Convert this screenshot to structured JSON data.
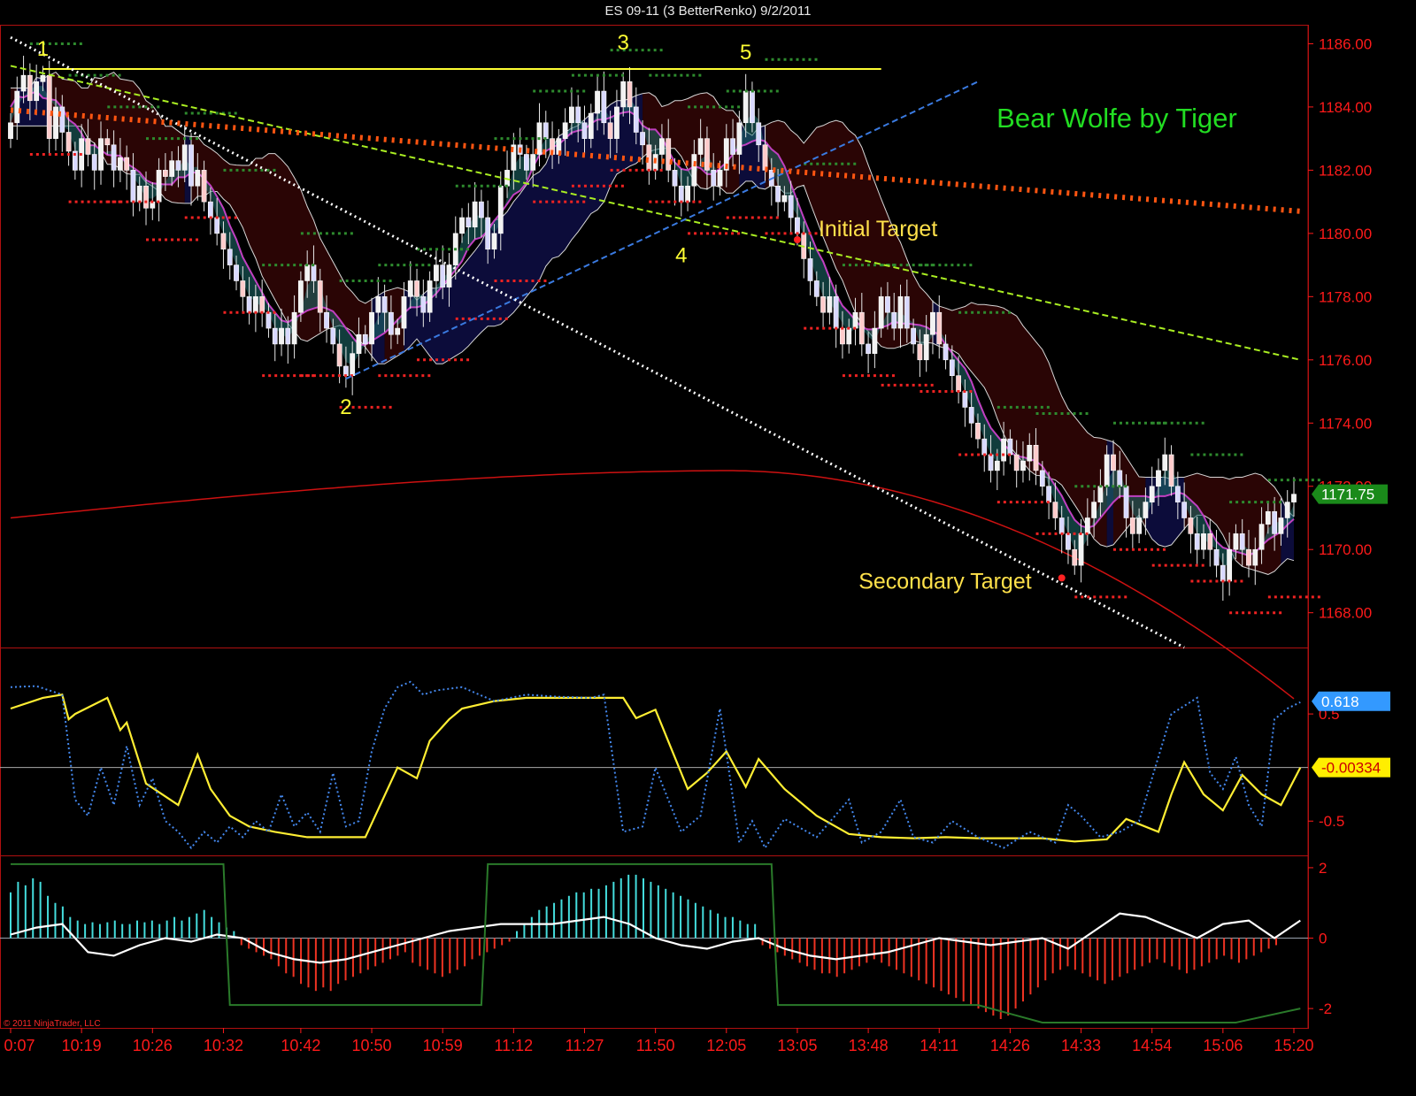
{
  "window": {
    "title": "ES 09-11 (3 BetterRenko)  9/2/2011"
  },
  "copyright": "© 2011 NinjaTrader, LLC",
  "colors": {
    "background": "#000000",
    "axis_text": "#ff1a1a",
    "panel_border": "#b01010",
    "wave_label": "#ffff33",
    "study_title": "#22dd22",
    "last_price_tag": "#1a8a1a",
    "osc_tag_blue": "#3399ff",
    "osc_tag_yellow": "#ffee00"
  },
  "chart_data": [
    {
      "type": "candlestick",
      "panel": "price",
      "title": "Bear Wolfe by Tiger",
      "ylim": [
        1166.9,
        1186.6
      ],
      "y_ticks": [
        "1186.00",
        "1184.00",
        "1182.00",
        "1180.00",
        "1178.00",
        "1176.00",
        "1174.00",
        "1172.00",
        "1170.00",
        "1168.00"
      ],
      "last_price": "1171.75",
      "wave_points": [
        {
          "label": "1",
          "bar": 5,
          "price": 1185.0
        },
        {
          "label": "2",
          "bar": 52,
          "price": 1175.3
        },
        {
          "label": "3",
          "bar": 95,
          "price": 1185.2
        },
        {
          "label": "4",
          "bar": 104,
          "price": 1180.1
        },
        {
          "label": "5",
          "bar": 114,
          "price": 1184.9
        }
      ],
      "targets": [
        {
          "label": "Initial Target",
          "bar": 122,
          "price": 1179.8
        },
        {
          "label": "Secondary Target",
          "bar": 163,
          "price": 1169.1
        }
      ],
      "annotation_lines": [
        {
          "name": "resistance-3-5",
          "price": 1185.2,
          "from_bar": 5,
          "to_bar": 135
        },
        {
          "name": "target-1-4",
          "from": [
            0,
            1185.3
          ],
          "to": [
            200,
            1176.0
          ]
        },
        {
          "name": "line-2-4",
          "from": [
            52,
            1175.4
          ],
          "to": [
            150,
            1184.8
          ]
        },
        {
          "name": "line-1-3",
          "from": [
            0,
            1186.2
          ],
          "to": [
            182,
            1166.9
          ]
        },
        {
          "name": "moving-avg-dots",
          "from": [
            0,
            1183.9
          ],
          "to": [
            200,
            1180.7
          ]
        }
      ],
      "closes": [
        1183.5,
        1184.5,
        1185.0,
        1184.2,
        1184.8,
        1185.0,
        1183.0,
        1184.0,
        1183.2,
        1182.6,
        1182.0,
        1183.0,
        1182.5,
        1182.0,
        1183.0,
        1182.8,
        1182.0,
        1182.4,
        1182.0,
        1181.0,
        1181.5,
        1180.8,
        1181.0,
        1182.0,
        1181.8,
        1182.3,
        1182.0,
        1182.8,
        1181.5,
        1182.0,
        1181.0,
        1180.5,
        1180.0,
        1179.5,
        1179.0,
        1178.5,
        1178.0,
        1177.5,
        1178.0,
        1177.5,
        1177.0,
        1176.5,
        1177.0,
        1176.5,
        1177.5,
        1178.5,
        1179.0,
        1178.5,
        1177.5,
        1177.0,
        1176.5,
        1175.8,
        1175.5,
        1176.2,
        1176.8,
        1176.5,
        1177.5,
        1178.0,
        1177.5,
        1176.8,
        1177.0,
        1178.0,
        1178.5,
        1178.0,
        1177.5,
        1178.5,
        1179.0,
        1178.3,
        1179.0,
        1180.0,
        1180.5,
        1180.2,
        1181.0,
        1180.5,
        1179.5,
        1180.0,
        1181.5,
        1182.0,
        1182.8,
        1182.5,
        1182.0,
        1182.5,
        1183.5,
        1183.0,
        1182.5,
        1183.0,
        1183.5,
        1184.0,
        1183.5,
        1183.0,
        1183.8,
        1184.5,
        1183.5,
        1183.0,
        1184.0,
        1184.8,
        1184.0,
        1183.2,
        1182.8,
        1182.0,
        1182.5,
        1183.0,
        1182.0,
        1181.5,
        1181.0,
        1181.5,
        1182.5,
        1183.0,
        1182.0,
        1181.5,
        1182.0,
        1183.0,
        1182.5,
        1183.5,
        1184.5,
        1183.5,
        1182.8,
        1182.0,
        1181.5,
        1181.0,
        1181.2,
        1180.5,
        1180.0,
        1179.2,
        1178.5,
        1178.0,
        1177.5,
        1178.0,
        1177.0,
        1176.5,
        1177.0,
        1177.5,
        1176.5,
        1176.2,
        1177.0,
        1178.0,
        1177.5,
        1177.0,
        1178.0,
        1177.0,
        1176.5,
        1176.0,
        1176.8,
        1177.5,
        1176.5,
        1176.0,
        1175.5,
        1175.0,
        1174.5,
        1174.0,
        1173.5,
        1173.0,
        1172.5,
        1172.8,
        1173.5,
        1173.0,
        1172.5,
        1172.8,
        1173.3,
        1172.5,
        1172.0,
        1171.5,
        1171.0,
        1170.5,
        1170.0,
        1169.5,
        1170.5,
        1171.0,
        1171.5,
        1172.0,
        1173.0,
        1172.5,
        1172.0,
        1171.0,
        1170.5,
        1171.0,
        1171.5,
        1172.0,
        1172.5,
        1173.0,
        1172.0,
        1171.5,
        1171.0,
        1170.5,
        1170.0,
        1170.5,
        1170.0,
        1169.5,
        1169.0,
        1170.0,
        1170.5,
        1170.0,
        1169.5,
        1170.0,
        1170.8,
        1171.2,
        1170.5,
        1171.0,
        1171.5,
        1171.75
      ]
    },
    {
      "type": "line",
      "panel": "oscillator",
      "ylim": [
        -0.82,
        1.12
      ],
      "y_ticks": [
        "0.5",
        "-0.5"
      ],
      "zero_line": 0,
      "tags": [
        {
          "text": "0.618",
          "value": 0.618,
          "color": "#3399ff"
        },
        {
          "text": "-0.00334",
          "value": 0.0,
          "color": "#ffee00"
        }
      ],
      "series": [
        {
          "style": "solid",
          "color": "#ffee33",
          "x": [
            0,
            5,
            8,
            9,
            10,
            15,
            17,
            18,
            21,
            26,
            29,
            31,
            34,
            37,
            41,
            46,
            50,
            55,
            60,
            63,
            65,
            68,
            70,
            75,
            80,
            85,
            90,
            95,
            97,
            100,
            105,
            108,
            111,
            114,
            116,
            120,
            125,
            130,
            135,
            140,
            145,
            150,
            155,
            160,
            165,
            170,
            173,
            178,
            180,
            182,
            185,
            188,
            191,
            194,
            197,
            200
          ],
          "y": [
            0.55,
            0.65,
            0.68,
            0.45,
            0.5,
            0.65,
            0.35,
            0.42,
            -0.15,
            -0.35,
            0.12,
            -0.2,
            -0.45,
            -0.55,
            -0.6,
            -0.65,
            -0.65,
            -0.65,
            0.0,
            -0.1,
            0.25,
            0.45,
            0.55,
            0.62,
            0.65,
            0.65,
            0.65,
            0.65,
            0.46,
            0.54,
            -0.2,
            -0.05,
            0.15,
            -0.18,
            0.08,
            -0.2,
            -0.45,
            -0.62,
            -0.65,
            -0.66,
            -0.65,
            -0.66,
            -0.66,
            -0.66,
            -0.69,
            -0.67,
            -0.48,
            -0.6,
            -0.25,
            0.05,
            -0.25,
            -0.4,
            -0.07,
            -0.25,
            -0.35,
            0.0
          ]
        },
        {
          "style": "dotted",
          "color": "#4488ee",
          "x": [
            0,
            4,
            8,
            10,
            12,
            14,
            16,
            18,
            20,
            22,
            24,
            26,
            28,
            30,
            32,
            34,
            36,
            38,
            40,
            42,
            44,
            46,
            48,
            50,
            52,
            54,
            56,
            58,
            60,
            62,
            64,
            66,
            70,
            75,
            80,
            85,
            90,
            92,
            95,
            98,
            100,
            104,
            107,
            110,
            113,
            115,
            117,
            120,
            125,
            130,
            132,
            135,
            138,
            140,
            143,
            146,
            150,
            154,
            158,
            162,
            164,
            166,
            169,
            172,
            175,
            180,
            184,
            186,
            188,
            190,
            192,
            194,
            196,
            198,
            200
          ],
          "y": [
            0.75,
            0.76,
            0.68,
            -0.3,
            -0.45,
            0.0,
            -0.35,
            0.2,
            -0.35,
            -0.1,
            -0.5,
            -0.6,
            -0.75,
            -0.6,
            -0.7,
            -0.55,
            -0.65,
            -0.5,
            -0.6,
            -0.25,
            -0.55,
            -0.42,
            -0.6,
            -0.05,
            -0.55,
            -0.5,
            0.15,
            0.55,
            0.75,
            0.8,
            0.68,
            0.72,
            0.75,
            0.62,
            0.68,
            0.66,
            0.65,
            0.68,
            -0.6,
            -0.55,
            0.0,
            -0.6,
            -0.45,
            0.55,
            -0.7,
            -0.5,
            -0.75,
            -0.48,
            -0.65,
            -0.3,
            -0.7,
            -0.6,
            -0.3,
            -0.65,
            -0.7,
            -0.5,
            -0.65,
            -0.75,
            -0.6,
            -0.7,
            -0.35,
            -0.45,
            -0.65,
            -0.6,
            -0.5,
            0.5,
            0.65,
            -0.05,
            -0.2,
            0.1,
            -0.35,
            -0.55,
            0.45,
            0.55,
            0.61
          ]
        }
      ]
    },
    {
      "type": "bar",
      "panel": "histogram",
      "ylim": [
        -2.55,
        2.35
      ],
      "y_ticks": [
        "2",
        "0",
        "-2"
      ],
      "positive_color": "#44dddd",
      "negative_color": "#ee3322",
      "histogram": [
        1.3,
        1.6,
        1.5,
        1.7,
        1.6,
        1.2,
        1.0,
        0.9,
        0.6,
        0.5,
        0.4,
        0.45,
        0.4,
        0.45,
        0.5,
        0.4,
        0.4,
        0.5,
        0.45,
        0.5,
        0.4,
        0.5,
        0.6,
        0.5,
        0.6,
        0.7,
        0.8,
        0.6,
        0.45,
        0.3,
        0.2,
        -0.2,
        -0.3,
        -0.4,
        -0.5,
        -0.6,
        -0.8,
        -1.0,
        -1.1,
        -1.3,
        -1.4,
        -1.5,
        -1.4,
        -1.5,
        -1.3,
        -1.2,
        -1.1,
        -1.0,
        -0.9,
        -0.8,
        -0.7,
        -0.6,
        -0.5,
        -0.4,
        -0.7,
        -0.8,
        -0.9,
        -1.0,
        -1.1,
        -1.0,
        -0.9,
        -0.8,
        -0.6,
        -0.5,
        -0.4,
        -0.3,
        -0.2,
        -0.1,
        0.2,
        0.4,
        0.6,
        0.8,
        0.9,
        1.0,
        1.1,
        1.2,
        1.3,
        1.3,
        1.4,
        1.4,
        1.5,
        1.6,
        1.7,
        1.8,
        1.8,
        1.7,
        1.6,
        1.5,
        1.4,
        1.3,
        1.2,
        1.1,
        1.0,
        0.9,
        0.8,
        0.7,
        0.6,
        0.6,
        0.5,
        0.4,
        0.4,
        -0.2,
        -0.3,
        -0.4,
        -0.5,
        -0.6,
        -0.7,
        -0.8,
        -0.9,
        -1.0,
        -1.0,
        -1.1,
        -1.0,
        -0.9,
        -0.8,
        -0.7,
        -0.6,
        -0.7,
        -0.8,
        -0.9,
        -1.0,
        -1.1,
        -1.2,
        -1.3,
        -1.4,
        -1.5,
        -1.6,
        -1.7,
        -1.8,
        -1.9,
        -2.0,
        -2.1,
        -2.2,
        -2.3,
        -2.2,
        -2.0,
        -1.8,
        -1.6,
        -1.4,
        -1.2,
        -1.0,
        -0.9,
        -0.8,
        -0.9,
        -1.0,
        -1.1,
        -1.2,
        -1.3,
        -1.2,
        -1.1,
        -1.0,
        -0.9,
        -0.8,
        -0.7,
        -0.6,
        -0.7,
        -0.8,
        -0.9,
        -1.0,
        -0.9,
        -0.8,
        -0.7,
        -0.6,
        -0.5,
        -0.6,
        -0.7,
        -0.6,
        -0.5,
        -0.4,
        -0.3,
        -0.2
      ],
      "series": [
        {
          "style": "line",
          "color": "#ffffff",
          "x": [
            0,
            4,
            8,
            12,
            16,
            20,
            24,
            28,
            32,
            36,
            40,
            44,
            48,
            52,
            56,
            60,
            64,
            68,
            72,
            76,
            80,
            84,
            88,
            92,
            96,
            100,
            104,
            108,
            112,
            116,
            120,
            124,
            128,
            132,
            136,
            140,
            144,
            148,
            152,
            156,
            160,
            164,
            168,
            172,
            176,
            180,
            184,
            188,
            192,
            196,
            200
          ],
          "y": [
            0.1,
            0.3,
            0.4,
            -0.4,
            -0.5,
            -0.2,
            0.0,
            -0.1,
            0.1,
            0.0,
            -0.4,
            -0.6,
            -0.7,
            -0.6,
            -0.4,
            -0.2,
            0.0,
            0.2,
            0.3,
            0.4,
            0.4,
            0.4,
            0.5,
            0.6,
            0.4,
            0.0,
            -0.2,
            -0.3,
            -0.1,
            0.0,
            -0.3,
            -0.5,
            -0.6,
            -0.5,
            -0.4,
            -0.2,
            0.0,
            -0.1,
            -0.2,
            -0.1,
            0.0,
            -0.3,
            0.2,
            0.7,
            0.6,
            0.3,
            0.0,
            0.4,
            0.5,
            0.0,
            0.5
          ]
        },
        {
          "style": "step",
          "color": "#2a7a2a",
          "x": [
            0,
            33,
            33.5,
            34,
            73,
            73.5,
            74,
            118,
            118.5,
            119,
            150,
            160,
            190,
            200
          ],
          "y": [
            2.1,
            2.1,
            0.0,
            -1.9,
            -1.9,
            0.0,
            2.1,
            2.1,
            0.0,
            -1.9,
            -1.9,
            -2.4,
            -2.4,
            -2.0
          ]
        }
      ]
    }
  ],
  "time_axis": {
    "labels": [
      "0:07",
      "10:19",
      "10:26",
      "10:32",
      "10:42",
      "10:50",
      "10:59",
      "11:12",
      "11:27",
      "11:50",
      "12:05",
      "13:05",
      "13:48",
      "14:11",
      "14:26",
      "14:33",
      "14:54",
      "15:06",
      "15:20"
    ],
    "bars": [
      0,
      11,
      22,
      33,
      45,
      56,
      67,
      78,
      89,
      100,
      111,
      122,
      133,
      144,
      155,
      166,
      177,
      188,
      199
    ]
  }
}
